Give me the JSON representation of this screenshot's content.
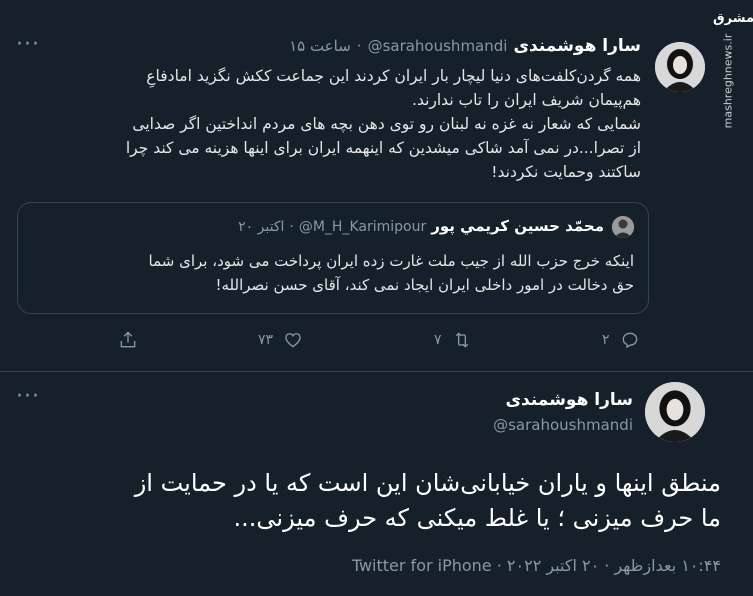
{
  "watermark": {
    "logo_text": "مشرق",
    "site": "mashreghnews.ir"
  },
  "tweet": {
    "author_name": "سارا هوشمندی",
    "author_handle": "@sarahoushmandi",
    "separator": "·",
    "time": "۱۵ ساعت",
    "more_label": "···",
    "lines": [
      "همه گردن‌کلفت‌های دنیا لیچار بار ایران کردند این جماعت ککش نگزید امادفاعِ",
      "هم‌پیمان شریف ایران را تاب ندارند.",
      "شمایی که شعار نه غزه نه لبنان رو توی دهن بچه های مردم انداختین اگر صدایی",
      "از تصرا...در نمی آمد شاکی میشدین که اینهمه ایران برای اینها هزینه می کند چرا",
      "ساکتند وحمایت نکردند!"
    ],
    "quoted": {
      "author_name": "محمّد حسين كريمي پور",
      "author_handle": "@M_H_Karimipour",
      "separator": "·",
      "date": "۲۰ اکتبر",
      "lines": [
        "اینکه خرج حزب الله از جیب ملت غارت زده ایران پرداخت می شود، برای شما",
        "حق دخالت در امور داخلی ایران ایجاد نمی کند، آقای حسن نصرالله!"
      ]
    },
    "actions": {
      "reply_icon": "reply-icon",
      "reply_count": "۲",
      "retweet_icon": "retweet-icon",
      "retweet_count": "۷",
      "like_icon": "heart-icon",
      "like_count": "۷۳",
      "share_icon": "share-icon"
    }
  },
  "reply": {
    "author_name": "سارا هوشمندی",
    "author_handle": "@sarahoushmandi",
    "more_label": "···",
    "lines": [
      "منطق اینها و یاران خیابانی‌شان این است که یا در حمایت از",
      "ما حرف میزنی ؛ یا غلط میکنی که حرف میزنی..."
    ],
    "meta": "۱۰:۴۴ بعدازظهر · ۲۰ اکتبر ۲۰۲۲ · Twitter for iPhone"
  },
  "colors": {
    "background": "#15202b",
    "secondary_text": "#8899a6",
    "border": "#38444d"
  }
}
